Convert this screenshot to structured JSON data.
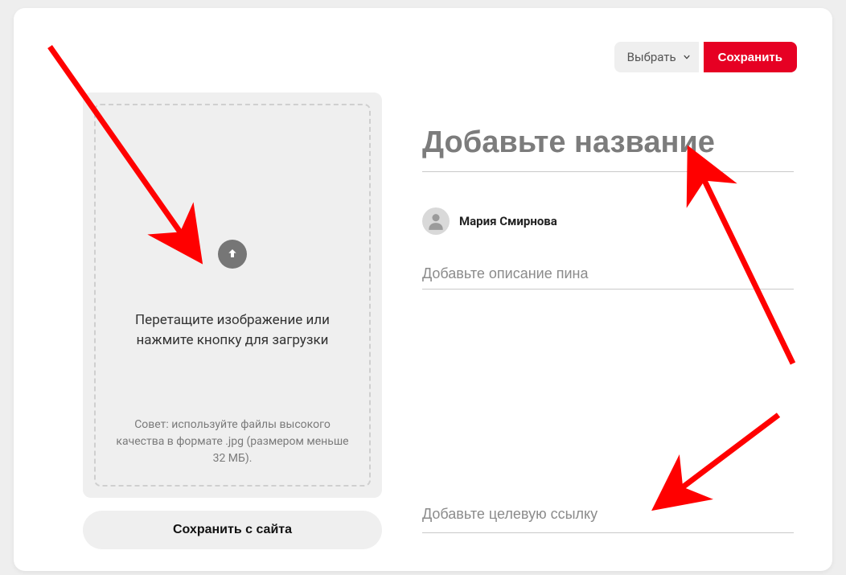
{
  "topbar": {
    "select_label": "Выбрать",
    "save_label": "Сохранить"
  },
  "upload": {
    "main_text": "Перетащите изображение или нажмите кнопку для загрузки",
    "tip_text": "Совет: используйте файлы высокого качества в формате .jpg (размером меньше 32 МБ)."
  },
  "save_from_site_label": "Сохранить с сайта",
  "form": {
    "title_placeholder": "Добавьте название",
    "author_name": "Мария Смирнова",
    "description_placeholder": "Добавьте описание пина",
    "link_placeholder": "Добавьте целевую ссылку"
  },
  "icons": {
    "chevron_down": "chevron-down-icon",
    "upload_arrow": "upload-arrow-icon",
    "user": "user-icon"
  },
  "colors": {
    "accent": "#e60023",
    "arrow": "#ff0000"
  }
}
